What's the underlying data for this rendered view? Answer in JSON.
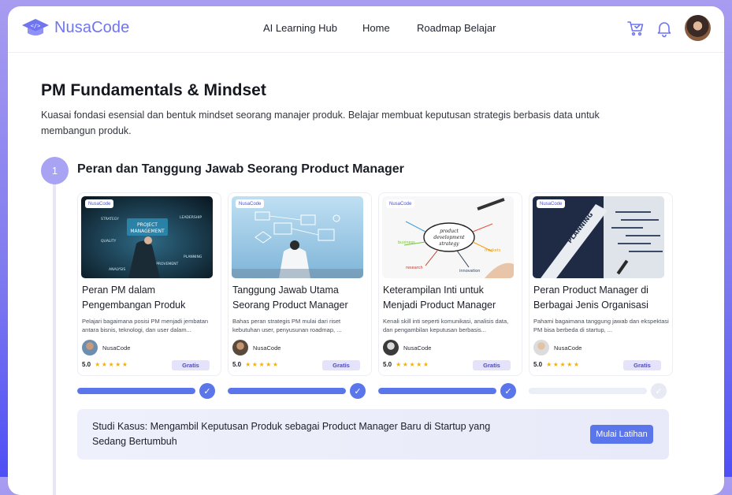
{
  "header": {
    "brand": "NusaCode",
    "nav": [
      "AI Learning Hub",
      "Home",
      "Roadmap Belajar"
    ],
    "icons": [
      "cart-icon",
      "bell-icon",
      "avatar"
    ]
  },
  "page": {
    "title": "PM Fundamentals & Mindset",
    "description": "Kuasai fondasi esensial dan bentuk mindset seorang manajer produk. Belajar membuat keputusan strategis berbasis data untuk membangun produk."
  },
  "section": {
    "number": "1",
    "title": "Peran dan Tanggung Jawab Seorang Product Manager"
  },
  "courses": [
    {
      "brand_chip": "NusaCode",
      "title": "Peran PM dalam Pengembangan Produk",
      "description": "Pelajari bagaimana posisi PM menjadi jembatan antara bisnis, teknologi, dan user dalam...",
      "author": "NusaCode",
      "rating": "5.0",
      "stars": "★★★★★",
      "badge": "Gratis",
      "progress": 1.0,
      "completed": true
    },
    {
      "brand_chip": "NusaCode",
      "title": "Tanggung Jawab Utama Seorang Product Manager",
      "description": "Bahas peran strategis PM mulai dari riset kebutuhan user, penyusunan roadmap, ...",
      "author": "NusaCode",
      "rating": "5.0",
      "stars": "★★★★★",
      "badge": "Gratis",
      "progress": 1.0,
      "completed": true
    },
    {
      "brand_chip": "NusaCode",
      "title": "Keterampilan Inti untuk Menjadi Product Manager",
      "description": "Kenali skill inti seperti komunikasi, analisis data, dan pengambilan keputusan berbasis...",
      "author": "NusaCode",
      "rating": "5.0",
      "stars": "★★★★★",
      "badge": "Gratis",
      "progress": 1.0,
      "completed": true
    },
    {
      "brand_chip": "NusaCode",
      "title": "Peran Product Manager di Berbagai Jenis Organisasi",
      "description": "Pahami bagaimana tanggung jawab dan ekspektasi PM bisa berbeda di startup, ...",
      "author": "NusaCode",
      "rating": "5.0",
      "stars": "★★★★★",
      "badge": "Gratis",
      "progress": 0.0,
      "completed": false
    }
  ],
  "case_study": {
    "text": "Studi Kasus: Mengambil Keputusan Produk sebagai Product Manager Baru di Startup yang Sedang Bertumbuh",
    "button": "Mulai Latihan"
  },
  "colors": {
    "accent": "#5a76ea",
    "brand": "#6f74f0",
    "badge_bg": "#e4e3fb",
    "star": "#f5b301"
  }
}
